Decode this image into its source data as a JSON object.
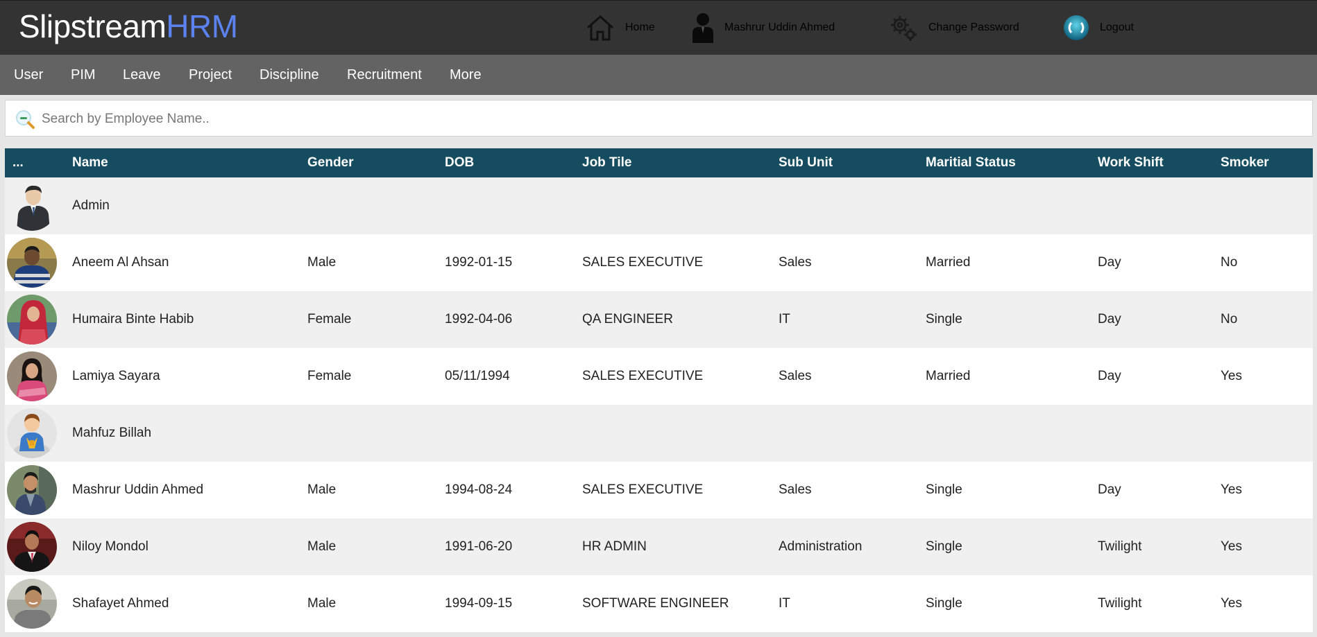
{
  "brand": {
    "main": "Slipstream",
    "accent": "HRM"
  },
  "topnav": {
    "home": "Home",
    "user": "Mashrur Uddin Ahmed",
    "change_password": "Change Password",
    "logout": "Logout"
  },
  "menu": [
    "User",
    "PIM",
    "Leave",
    "Project",
    "Discipline",
    "Recruitment",
    "More"
  ],
  "search": {
    "placeholder": "Search by Employee Name.."
  },
  "table": {
    "headers": [
      "...",
      "Name",
      "Gender",
      "DOB",
      "Job Tile",
      "Sub Unit",
      "Maritial Status",
      "Work Shift",
      "Smoker"
    ],
    "rows": [
      {
        "avatar": "admin-avatar",
        "name": "Admin",
        "gender": "",
        "dob": "",
        "job": "",
        "unit": "",
        "marital": "",
        "shift": "",
        "smoker": ""
      },
      {
        "avatar": "photo-avatar",
        "name": "Aneem Al Ahsan",
        "gender": "Male",
        "dob": "1992-01-15",
        "job": "SALES EXECUTIVE",
        "unit": "Sales",
        "marital": "Married",
        "shift": "Day",
        "smoker": "No"
      },
      {
        "avatar": "photo-avatar",
        "name": "Humaira Binte Habib",
        "gender": "Female",
        "dob": "1992-04-06",
        "job": "QA ENGINEER",
        "unit": "IT",
        "marital": "Single",
        "shift": "Day",
        "smoker": "No"
      },
      {
        "avatar": "photo-avatar",
        "name": "Lamiya Sayara",
        "gender": "Female",
        "dob": "05/11/1994",
        "job": "SALES EXECUTIVE",
        "unit": "Sales",
        "marital": "Married",
        "shift": "Day",
        "smoker": "Yes"
      },
      {
        "avatar": "cartoon-avatar",
        "name": "Mahfuz Billah",
        "gender": "",
        "dob": "",
        "job": "",
        "unit": "",
        "marital": "",
        "shift": "",
        "smoker": ""
      },
      {
        "avatar": "photo-avatar",
        "name": "Mashrur Uddin Ahmed",
        "gender": "Male",
        "dob": "1994-08-24",
        "job": "SALES EXECUTIVE",
        "unit": "Sales",
        "marital": "Single",
        "shift": "Day",
        "smoker": "Yes"
      },
      {
        "avatar": "photo-avatar",
        "name": "Niloy Mondol",
        "gender": "Male",
        "dob": "1991-06-20",
        "job": "HR ADMIN",
        "unit": "Administration",
        "marital": "Single",
        "shift": "Twilight",
        "smoker": "Yes"
      },
      {
        "avatar": "photo-avatar",
        "name": "Shafayet Ahmed",
        "gender": "Male",
        "dob": "1994-09-15",
        "job": "SOFTWARE ENGINEER",
        "unit": "IT",
        "marital": "Single",
        "shift": "Twilight",
        "smoker": "Yes"
      }
    ]
  },
  "colors": {
    "topbar": "#333333",
    "menubar": "#636363",
    "brand_accent": "#5b82ee",
    "table_header": "#164c5f",
    "row_odd": "#f0f0f0",
    "row_even": "#ffffff"
  }
}
